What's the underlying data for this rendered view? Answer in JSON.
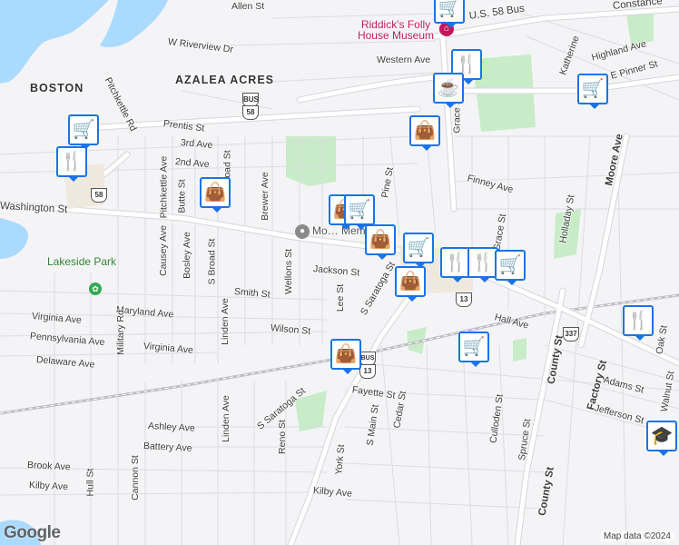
{
  "map": {
    "attribution": "Map data ©2024",
    "logo": "Google",
    "colors": {
      "water": "#aadaff",
      "park": "#c8ecc8",
      "road": "#ffffff",
      "road_outline": "#d6d6dc",
      "highway": "#ffffff",
      "railway": "#bdbdc4",
      "pin_border": "#1a73e8",
      "poi": "#c2185b"
    },
    "areas": [
      "BOSTON",
      "AZALEA ACRES"
    ],
    "parks": [
      "Lakeside Park"
    ],
    "pois": [
      {
        "name": "Riddick's Folly House Museum",
        "icon": "museum-icon"
      },
      {
        "name": "Mo… Memo…",
        "icon": "landmark-icon"
      }
    ],
    "streets": [
      "W Riverview Dr",
      "Pitchkettle Rd",
      "Prentis St",
      "3rd Ave",
      "2nd Ave",
      "Washington St",
      "Pitchkettle Ave",
      "Butte St",
      "N Broad St",
      "Brewer Ave",
      "Causey Ave",
      "Bosley Ave",
      "S Broad St",
      "Wellons St",
      "Jackson St",
      "Lee St",
      "Smith St",
      "Maryland Ave",
      "Virginia Ave",
      "Pennsylvania Ave",
      "Delaware Ave",
      "Military Rd",
      "Linden Ave",
      "Wilson St",
      "S Saratoga St",
      "Hall Ave",
      "Fayette St",
      "Ashley Ave",
      "Battery Ave",
      "Brook Ave",
      "Kilby Ave",
      "Cannon St",
      "Hull St",
      "Reno St",
      "York St",
      "S Main St",
      "Cedar St",
      "Culloden St",
      "Spruce St",
      "County St",
      "Factory St",
      "Adams St",
      "Jefferson St",
      "Walnut St",
      "Oak St",
      "Holladay St",
      "Moore Ave",
      "Katherine",
      "Highland Ave",
      "E Pinner St",
      "Western Ave",
      "U.S. 58 Bus",
      "Constance",
      "Finney Ave",
      "Pine St",
      "Grace St",
      "Allen St"
    ],
    "shields": [
      "BUS 58",
      "58",
      "13",
      "13",
      "BUS 13",
      "337"
    ],
    "pins": [
      {
        "icon": "shopping-cart-icon"
      },
      {
        "icon": "restaurant-icon"
      },
      {
        "icon": "coffee-icon"
      },
      {
        "icon": "shopping-bag-icon"
      },
      {
        "icon": "shopping-cart-icon"
      },
      {
        "icon": "restaurant-icon"
      },
      {
        "icon": "shopping-bag-icon"
      },
      {
        "icon": "shopping-bag-icon"
      },
      {
        "icon": "shopping-cart-icon"
      },
      {
        "icon": "shopping-bag-icon"
      },
      {
        "icon": "shopping-cart-icon"
      },
      {
        "icon": "restaurant-icon"
      },
      {
        "icon": "restaurant-icon"
      },
      {
        "icon": "shopping-cart-icon"
      },
      {
        "icon": "shopping-bag-icon"
      },
      {
        "icon": "shopping-cart-icon"
      },
      {
        "icon": "shopping-bag-icon"
      },
      {
        "icon": "restaurant-icon"
      },
      {
        "icon": "school-icon"
      },
      {
        "icon": "shopping-cart-icon"
      }
    ]
  }
}
